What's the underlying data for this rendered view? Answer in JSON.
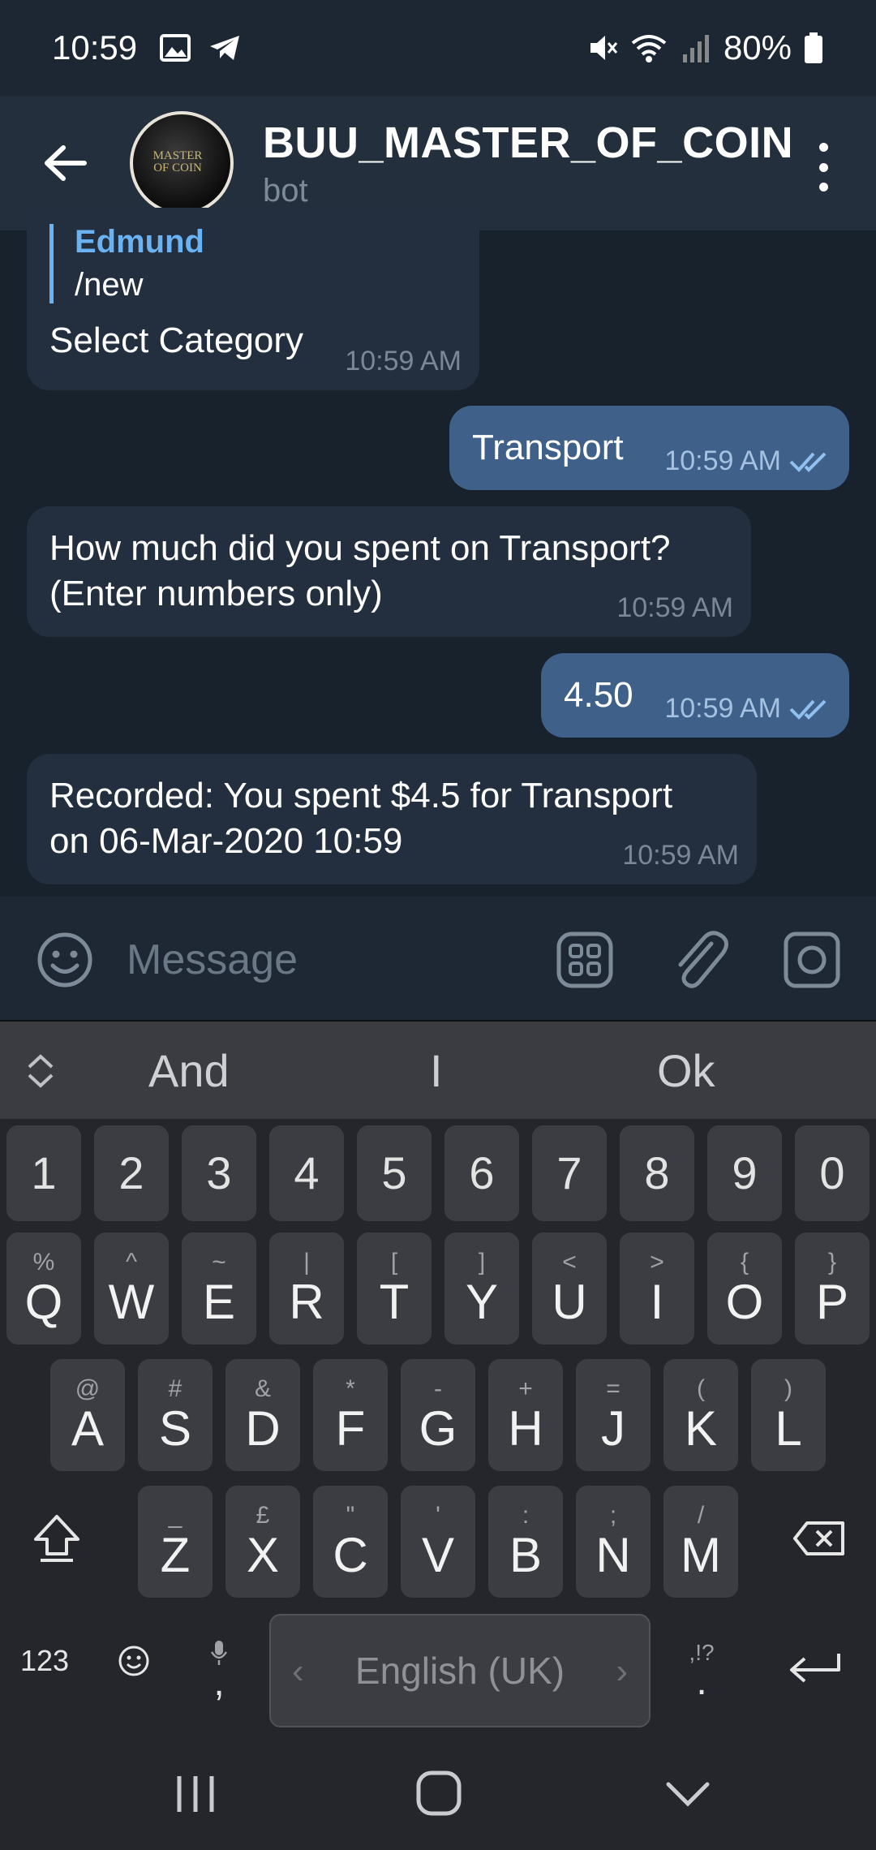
{
  "status_bar": {
    "time": "10:59",
    "battery": "80%"
  },
  "header": {
    "title": "BUU_MASTER_OF_COIN",
    "subtitle": "bot",
    "avatar_text": "MASTER OF COIN"
  },
  "messages": [
    {
      "direction": "in",
      "reply_name": "Edmund",
      "reply_text": "/new",
      "text": "Select Category",
      "time": "10:59 AM"
    },
    {
      "direction": "out",
      "text": "Transport",
      "time": "10:59 AM"
    },
    {
      "direction": "in",
      "text": "How much did you spent on Transport? (Enter numbers only)",
      "line1": "How much did you spent on Transport?",
      "line2": "(Enter numbers only)",
      "time": "10:59 AM"
    },
    {
      "direction": "out",
      "text": "4.50",
      "time": "10:59 AM"
    },
    {
      "direction": "in",
      "text": "Recorded: You spent $4.5 for Transport on 06-Mar-2020 10:59",
      "line1": "Recorded: You spent $4.5 for Transport",
      "line2": "on 06-Mar-2020 10:59",
      "time": "10:59 AM"
    }
  ],
  "input": {
    "placeholder": "Message"
  },
  "keyboard": {
    "suggestions": [
      "And",
      "I",
      "Ok"
    ],
    "number_row": [
      "1",
      "2",
      "3",
      "4",
      "5",
      "6",
      "7",
      "8",
      "9",
      "0"
    ],
    "row1": [
      [
        "Q",
        "%"
      ],
      [
        "W",
        "^"
      ],
      [
        "E",
        "~"
      ],
      [
        "R",
        "|"
      ],
      [
        "T",
        "["
      ],
      [
        "Y",
        "]"
      ],
      [
        "U",
        "<"
      ],
      [
        "I",
        ">"
      ],
      [
        "O",
        "{"
      ],
      [
        "P",
        "}"
      ]
    ],
    "row2": [
      [
        "A",
        "@"
      ],
      [
        "S",
        "#"
      ],
      [
        "D",
        "&"
      ],
      [
        "F",
        "*"
      ],
      [
        "G",
        "-"
      ],
      [
        "H",
        "+"
      ],
      [
        "J",
        "="
      ],
      [
        "K",
        "("
      ],
      [
        "L",
        ")"
      ]
    ],
    "row3": [
      [
        "Z",
        "_"
      ],
      [
        "X",
        "£"
      ],
      [
        "C",
        "\""
      ],
      [
        "V",
        "'"
      ],
      [
        "B",
        ":"
      ],
      [
        "N",
        ";"
      ],
      [
        "M",
        "/"
      ]
    ],
    "mode_key": "123",
    "comma": ",",
    "period": ".",
    "period_alt": ",!?",
    "space_label": "English (UK)"
  },
  "colors": {
    "background": "#18222d",
    "header": "#232f3d",
    "incoming_bubble": "#232f3e",
    "outgoing_bubble": "#3e6089",
    "reply_accent": "#6ab2f2",
    "keyboard": "#24262b",
    "key": "#3b3d42"
  }
}
